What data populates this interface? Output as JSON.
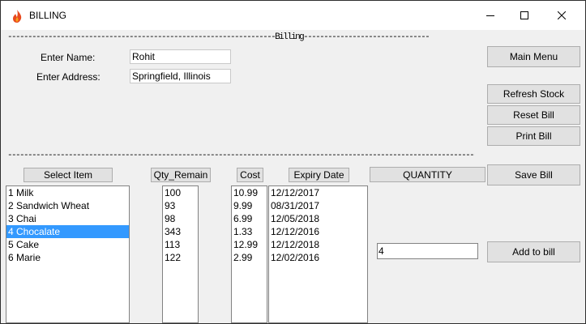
{
  "window": {
    "title": "BILLING"
  },
  "separators": {
    "top": "------------------------------------------------------------------Billing------------------------------------------------------------------------------------",
    "mid": "--------------------------------------------------------------------------------------------------------------------------------------------------------------------------"
  },
  "form": {
    "name_label": "Enter Name:",
    "name_value": "Rohit",
    "address_label": "Enter Address:",
    "address_value": "Springfield, Illinois"
  },
  "buttons": {
    "main_menu": "Main Menu",
    "refresh_stock": "Refresh Stock",
    "reset_bill": "Reset Bill",
    "print_bill": "Print Bill",
    "save_bill": "Save Bill",
    "add_to_bill": "Add to bill"
  },
  "headers": {
    "select_item": "Select Item",
    "qty_remain": "Qty_Remain",
    "cost": "Cost",
    "expiry_date": "Expiry Date",
    "quantity": "QUANTITY"
  },
  "items": [
    "1 Milk",
    "2 Sandwich Wheat",
    "3 Chai",
    "4 Chocalate",
    "5 Cake",
    "6 Marie"
  ],
  "selected_index": 3,
  "qty_remain": [
    "100",
    "93",
    "98",
    "343",
    "113",
    "122"
  ],
  "cost": [
    "10.99",
    "9.99",
    "6.99",
    "1.33",
    "12.99",
    "2.99"
  ],
  "expiry": [
    "12/12/2017",
    "08/31/2017",
    "12/05/2018",
    "12/12/2016",
    "12/12/2018",
    "12/02/2016"
  ],
  "quantity_value": "4"
}
